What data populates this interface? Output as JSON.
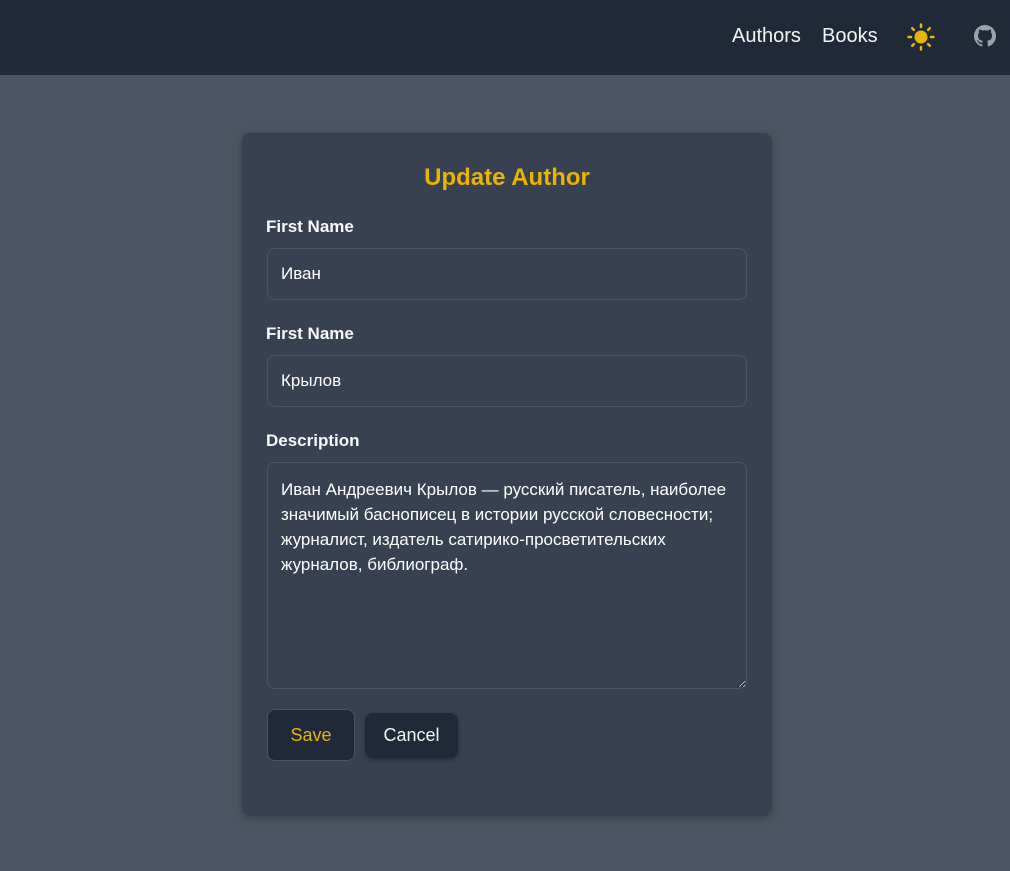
{
  "nav": {
    "authors_label": "Authors",
    "books_label": "Books",
    "theme_icon": "sun-icon",
    "github_icon": "github-icon"
  },
  "form": {
    "title": "Update Author",
    "first_name_label": "First Name",
    "first_name_value": "Иван",
    "last_name_label": "First Name",
    "last_name_value": "Крылов",
    "description_label": "Description",
    "description_value": "Иван Андреевич Крылов — русский писатель, наиболее значимый баснописец в истории русской словесности; журналист, издатель сатирико-просветительских журналов, библиограф.",
    "save_label": "Save",
    "cancel_label": "Cancel"
  },
  "colors": {
    "accent": "#eab308",
    "navbar_bg": "#1f2937",
    "page_bg": "#4b5563",
    "card_bg": "#374151"
  }
}
